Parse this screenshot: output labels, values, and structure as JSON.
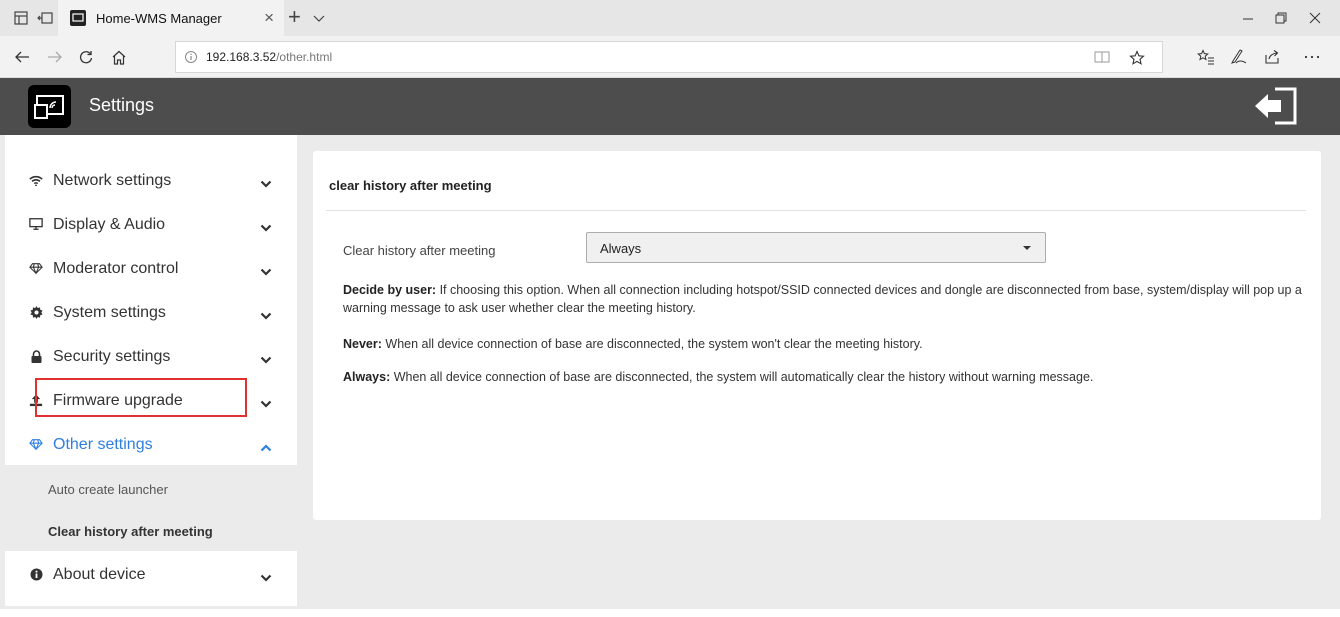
{
  "browser": {
    "tab_title": "Home-WMS Manager",
    "tab_close": "×",
    "new_tab": "+",
    "url_host": "192.168.3.52",
    "url_path": "/other.html"
  },
  "header": {
    "title": "Settings"
  },
  "sidebar": {
    "items": [
      {
        "label": "Network settings",
        "icon": "wifi-icon"
      },
      {
        "label": "Display & Audio",
        "icon": "monitor-icon"
      },
      {
        "label": "Moderator control",
        "icon": "diamond-icon"
      },
      {
        "label": "System settings",
        "icon": "gear-icon"
      },
      {
        "label": "Security settings",
        "icon": "lock-icon"
      },
      {
        "label": "Firmware upgrade",
        "icon": "upload-icon"
      },
      {
        "label": "Other settings",
        "icon": "diamond-icon"
      },
      {
        "label": "About device",
        "icon": "info-icon"
      }
    ],
    "sub_items": [
      {
        "label": "Auto create launcher"
      },
      {
        "label": "Clear history after meeting"
      }
    ]
  },
  "panel": {
    "title": "clear history after meeting",
    "field_label": "Clear history after meeting",
    "select_value": "Always",
    "descriptions": [
      {
        "term": "Decide by user:",
        "text": " If choosing this option. When all connection including hotspot/SSID connected devices and dongle are disconnected from base, system/display will pop up a warning message to ask user whether clear the meeting history."
      },
      {
        "term": "Never:",
        "text": " When all device connection of base are disconnected, the system won't clear the meeting history."
      },
      {
        "term": "Always:",
        "text": " When all device connection of base are disconnected, the system will automatically clear the history without warning message."
      }
    ]
  },
  "colors": {
    "header_bg": "#4d4d4d",
    "accent": "#2f7fe0",
    "highlight_box": "#e03030"
  }
}
